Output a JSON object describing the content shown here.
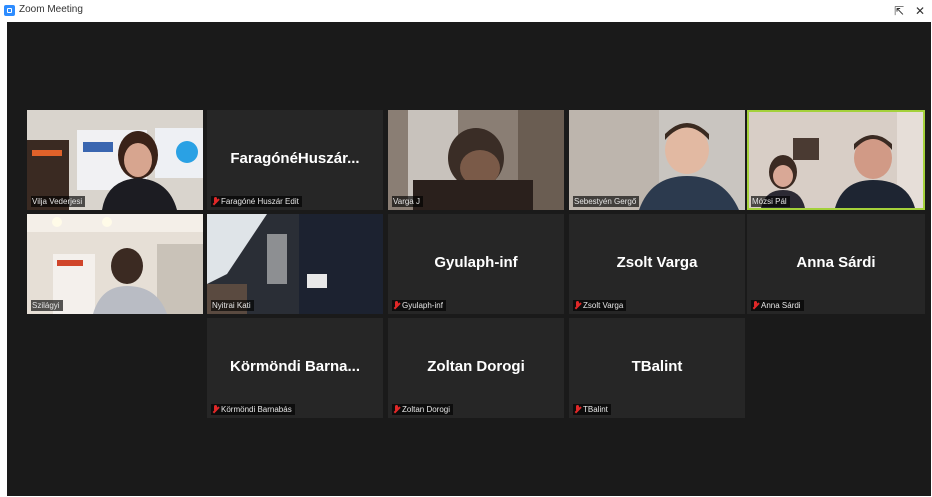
{
  "window": {
    "title": "Zoom Meeting",
    "maximize_glyph": "⇱",
    "close_glyph": "✕"
  },
  "tiles": [
    {
      "display_name": "",
      "tag": "Vilja Vederjesi",
      "has_video": true
    },
    {
      "display_name": "FaragónéHuszár...",
      "tag": "Faragóné Huszár Edit",
      "has_video": false
    },
    {
      "display_name": "",
      "tag": "Varga J",
      "has_video": true
    },
    {
      "display_name": "",
      "tag": "Sebestyén Gergő",
      "has_video": true
    },
    {
      "display_name": "",
      "tag": "Mózsi Pál",
      "has_video": true,
      "active_speaker": true
    },
    {
      "display_name": "",
      "tag": "Szilágyi",
      "has_video": true
    },
    {
      "display_name": "",
      "tag": "Nyitrai Kati",
      "has_video": true
    },
    {
      "display_name": "Gyulaph-inf",
      "tag": "Gyulaph-inf",
      "has_video": false
    },
    {
      "display_name": "Zsolt Varga",
      "tag": "Zsolt Varga",
      "has_video": false
    },
    {
      "display_name": "Anna Sárdi",
      "tag": "Anna Sárdi",
      "has_video": false
    },
    {
      "display_name": "Körmöndi Barna...",
      "tag": "Körmöndi Barnabás",
      "has_video": false
    },
    {
      "display_name": "Zoltan Dorogi",
      "tag": "Zoltan Dorogi",
      "has_video": false
    },
    {
      "display_name": "TBalint",
      "tag": "TBalint",
      "has_video": false
    }
  ],
  "colors": {
    "stage_bg": "#1a1a1a",
    "tile_bg": "#262626",
    "active_border": "#a4d13b",
    "muted_icon": "#e02828"
  }
}
